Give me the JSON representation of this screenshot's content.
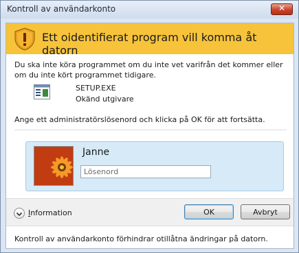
{
  "window": {
    "title": "Kontroll av användarkonto",
    "close_symbol": "✕"
  },
  "banner": {
    "text": "Ett oidentifierat program vill komma åt datorn",
    "icon": "shield-warning-icon",
    "color": "#f7c33a"
  },
  "description": "Du ska inte köra programmet om du inte vet varifrån det kommer eller om du inte kört programmet tidigare.",
  "program": {
    "file_name": "SETUP.EXE",
    "publisher": "Okänd utgivare",
    "icon": "application-icon"
  },
  "instruction": "Ange ett administratörslösenord och klicka på OK för att fortsätta.",
  "user": {
    "name": "Janne",
    "password_placeholder": "Lösenord",
    "avatar_icon": "flower-avatar-icon"
  },
  "footer": {
    "details_first": "I",
    "details_rest": "nformation",
    "ok_label": "OK",
    "cancel_label": "Avbryt"
  },
  "bottom_text": "Kontroll av användarkonto förhindrar otillåtna ändringar på datorn."
}
